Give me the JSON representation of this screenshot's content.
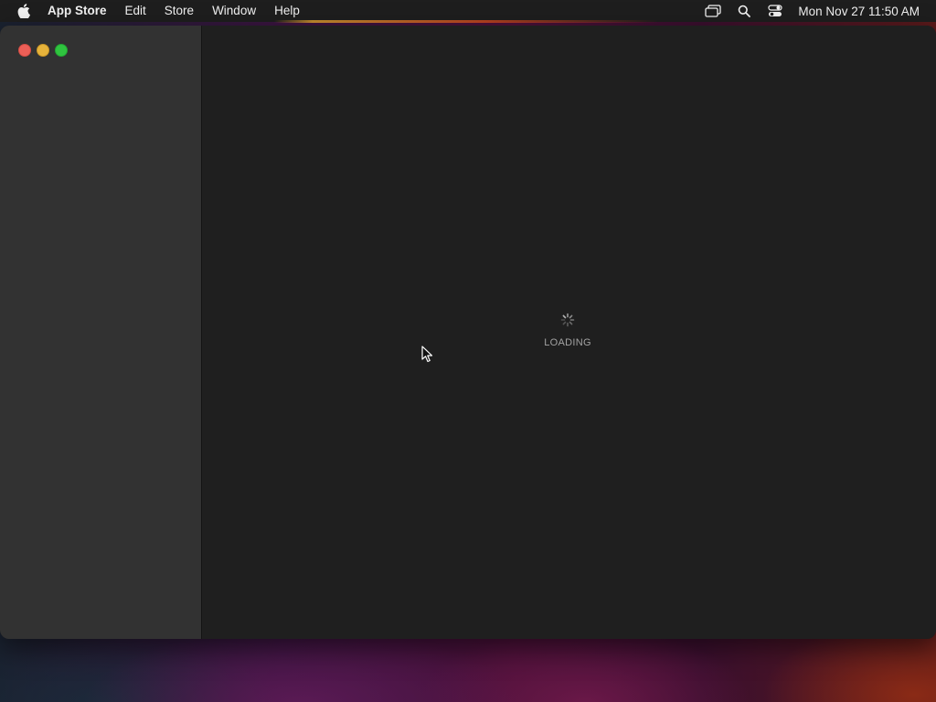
{
  "menubar": {
    "apple_icon": "apple-logo-icon",
    "app_name": "App Store",
    "items": [
      {
        "label": "Edit"
      },
      {
        "label": "Store"
      },
      {
        "label": "Window"
      },
      {
        "label": "Help"
      }
    ],
    "status_icons": [
      "screen-mirroring-icon",
      "spotlight-search-icon",
      "control-center-icon"
    ],
    "clock": "Mon Nov 27  11:50 AM"
  },
  "window": {
    "traffic_lights": {
      "close_color": "#ec5f57",
      "minimize_color": "#e6b33b",
      "maximize_color": "#2fc43f"
    }
  },
  "content": {
    "loading_label": "LOADING",
    "spinner_icon": "activity-spinner-icon"
  },
  "colors": {
    "menubar_bg": "#1e1e1e",
    "sidebar_bg": "#323232",
    "content_bg": "#1f1f1f",
    "loading_text": "#a3a3a3"
  }
}
